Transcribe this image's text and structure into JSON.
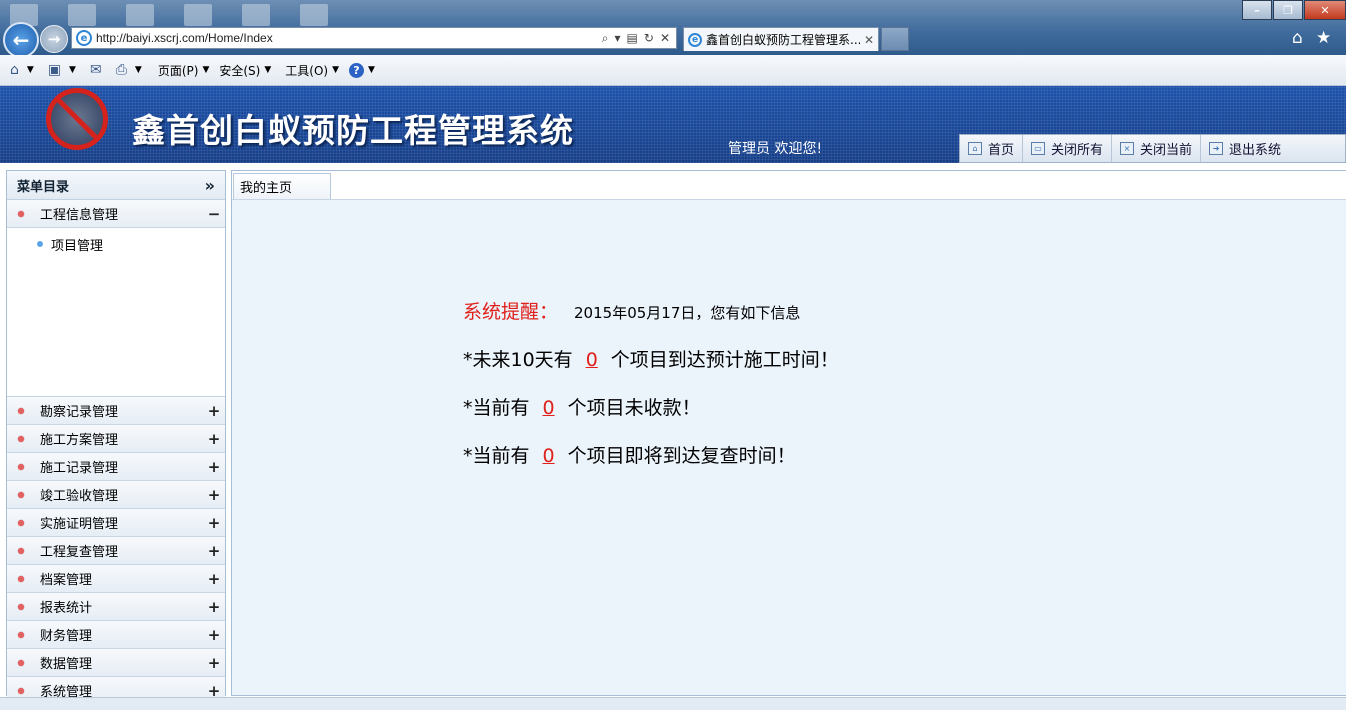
{
  "browser": {
    "url": "http://baiyi.xscrj.com/Home/Index",
    "tab_title": "鑫首创白蚁预防工程管理系...",
    "menu": [
      "页面(P)",
      "安全(S)",
      "工具(O)"
    ]
  },
  "header": {
    "title": "鑫首创白蚁预防工程管理系统",
    "welcome": "管理员 欢迎您!",
    "buttons": [
      "首页",
      "关闭所有",
      "关闭当前",
      "退出系统"
    ]
  },
  "sidebar": {
    "title": "菜单目录",
    "collapse_symbol": "»",
    "open_group": {
      "label": "工程信息管理",
      "sign": "−",
      "items": [
        "项目管理"
      ]
    },
    "groups": [
      {
        "label": "勘察记录管理",
        "sign": "+"
      },
      {
        "label": "施工方案管理",
        "sign": "+"
      },
      {
        "label": "施工记录管理",
        "sign": "+"
      },
      {
        "label": "竣工验收管理",
        "sign": "+"
      },
      {
        "label": "实施证明管理",
        "sign": "+"
      },
      {
        "label": "工程复查管理",
        "sign": "+"
      },
      {
        "label": "档案管理",
        "sign": "+"
      },
      {
        "label": "报表统计",
        "sign": "+"
      },
      {
        "label": "财务管理",
        "sign": "+"
      },
      {
        "label": "数据管理",
        "sign": "+"
      },
      {
        "label": "系统管理",
        "sign": "+"
      }
    ]
  },
  "main": {
    "tab": "我的主页",
    "notice": {
      "title": "系统提醒：",
      "date_text": "2015年05月17日，您有如下信息",
      "lines": [
        {
          "pre": "*未来10天有",
          "num": "0",
          "post": "个项目到达预计施工时间！"
        },
        {
          "pre": "*当前有",
          "num": "0",
          "post": "个项目未收款！"
        },
        {
          "pre": "*当前有",
          "num": "0",
          "post": "个项目即将到达复查时间！"
        }
      ]
    }
  },
  "colors": {
    "header_blue": "#1a4a9e",
    "alert_red": "#e0201a",
    "content_bg": "#ebf3fb"
  }
}
